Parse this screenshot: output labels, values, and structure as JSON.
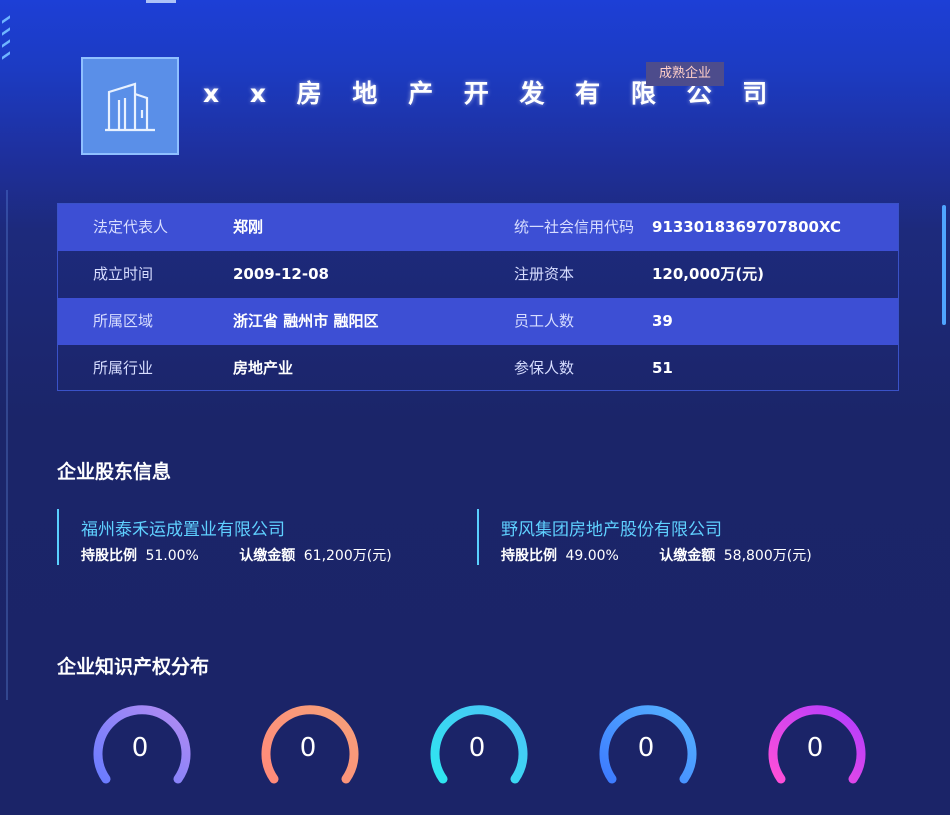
{
  "company": {
    "name": "x x 房 地 产 开 发 有 限 公 司",
    "badge": "成熟企业"
  },
  "info_rows": [
    {
      "label1": "法定代表人",
      "value1": "郑刚",
      "label2": "统一社会信用代码",
      "value2": "9133018369707800XC"
    },
    {
      "label1": "成立时间",
      "value1": "2009-12-08",
      "label2": "注册资本",
      "value2": "120,000万(元)"
    },
    {
      "label1": "所属区域",
      "value1": "浙江省 融州市 融阳区",
      "label2": "员工人数",
      "value2": "39"
    },
    {
      "label1": "所属行业",
      "value1": "房地产业",
      "label2": "参保人数",
      "value2": "51"
    }
  ],
  "shareholders": {
    "title": "企业股东信息",
    "items": [
      {
        "name": "福州泰禾运成置业有限公司",
        "ratio_label": "持股比例",
        "ratio": "51.00%",
        "amount_label": "认缴金额",
        "amount": "61,200万(元)"
      },
      {
        "name": "野风集团房地产股份有限公司",
        "ratio_label": "持股比例",
        "ratio": "49.00%",
        "amount_label": "认缴金额",
        "amount": "58,800万(元)"
      }
    ]
  },
  "ip": {
    "title": "企业知识产权分布",
    "rings": [
      {
        "value": "0",
        "color_start": "#6a7cff",
        "color_end": "#b48cf2"
      },
      {
        "value": "0",
        "color_start": "#ff8a7a",
        "color_end": "#f6a07a"
      },
      {
        "value": "0",
        "color_start": "#2ee6f0",
        "color_end": "#4cc3f7"
      },
      {
        "value": "0",
        "color_start": "#3d7bff",
        "color_end": "#56b3ff"
      },
      {
        "value": "0",
        "color_start": "#ff4fd8",
        "color_end": "#b13cff"
      }
    ]
  },
  "colors": {
    "accent": "#5fd0ff",
    "highlight_row": "#3d4fd4",
    "background": "#1b2468"
  }
}
